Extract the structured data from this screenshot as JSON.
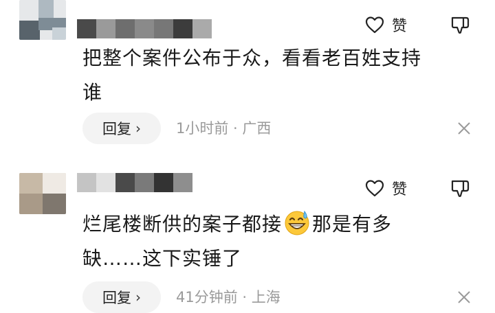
{
  "comments": [
    {
      "text_line1": "把整个案件公布于众，看看老百姓支持",
      "text_line2": "谁",
      "like_label": "赞",
      "reply_label": "回复",
      "reply_chevron": "›",
      "time": "1小时前",
      "separator": " · ",
      "location": "广西"
    },
    {
      "text_part1": "烂尾楼断供的案子都接",
      "text_part2": "那是有多",
      "text_line2": "缺……这下实锤了",
      "like_label": "赞",
      "reply_label": "回复",
      "reply_chevron": "›",
      "time": "41分钟前",
      "separator": " · ",
      "location": "上海"
    }
  ],
  "icons": {
    "like": "heart-outline-icon",
    "dislike": "thumbs-down-icon",
    "close": "close-icon",
    "emoji": "grinning-sweat-emoji"
  },
  "colors": {
    "text": "#1a1a1a",
    "meta": "#9a9a9a",
    "reply_bg": "#f3f3f3"
  }
}
